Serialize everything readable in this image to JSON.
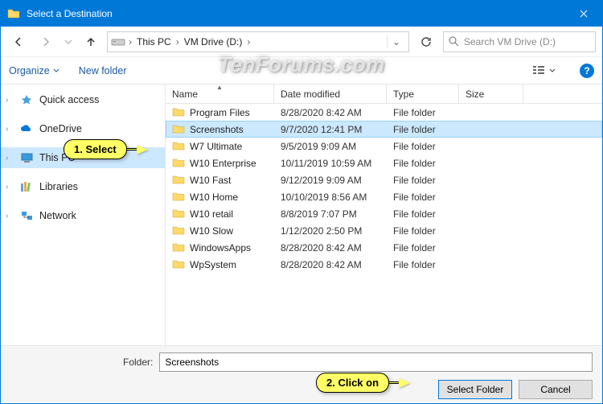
{
  "title": "Select a Destination",
  "breadcrumb": {
    "seg1": "This PC",
    "seg2": "VM Drive (D:)"
  },
  "search": {
    "placeholder": "Search VM Drive (D:)"
  },
  "toolbar": {
    "organize": "Organize",
    "new_folder": "New folder"
  },
  "sidebar": {
    "items": [
      {
        "label": "Quick access"
      },
      {
        "label": "OneDrive"
      },
      {
        "label": "This PC"
      },
      {
        "label": "Libraries"
      },
      {
        "label": "Network"
      }
    ]
  },
  "columns": {
    "name": "Name",
    "date": "Date modified",
    "type": "Type",
    "size": "Size"
  },
  "rows": [
    {
      "name": "Program Files",
      "date": "8/28/2020 8:42 AM",
      "type": "File folder"
    },
    {
      "name": "Screenshots",
      "date": "9/7/2020 12:41 PM",
      "type": "File folder"
    },
    {
      "name": "W7 Ultimate",
      "date": "9/5/2019 9:09 AM",
      "type": "File folder"
    },
    {
      "name": "W10 Enterprise",
      "date": "10/11/2019 10:59 AM",
      "type": "File folder"
    },
    {
      "name": "W10 Fast",
      "date": "9/12/2019 9:09 AM",
      "type": "File folder"
    },
    {
      "name": "W10 Home",
      "date": "10/10/2019 8:56 AM",
      "type": "File folder"
    },
    {
      "name": "W10 retail",
      "date": "8/8/2019 7:07 PM",
      "type": "File folder"
    },
    {
      "name": "W10 Slow",
      "date": "1/12/2020 2:50 PM",
      "type": "File folder"
    },
    {
      "name": "WindowsApps",
      "date": "8/28/2020 8:42 AM",
      "type": "File folder"
    },
    {
      "name": "WpSystem",
      "date": "8/28/2020 8:42 AM",
      "type": "File folder"
    }
  ],
  "selected_row": 1,
  "folder_label": "Folder:",
  "folder_value": "Screenshots",
  "buttons": {
    "select": "Select Folder",
    "cancel": "Cancel"
  },
  "callouts": {
    "step1": "1. Select",
    "step2": "2. Click on"
  },
  "watermark": "TenForums.com",
  "help_glyph": "?"
}
